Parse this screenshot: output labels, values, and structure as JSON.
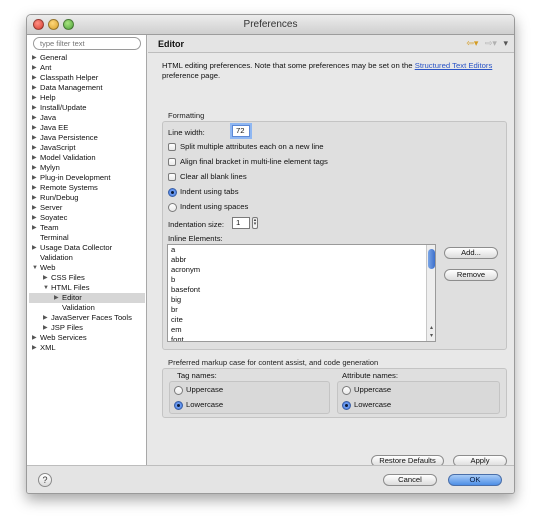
{
  "window": {
    "title": "Preferences"
  },
  "left": {
    "filter_placeholder": "type filter text",
    "tree": [
      {
        "label": "General",
        "indent": 0,
        "arrow": "right"
      },
      {
        "label": "Ant",
        "indent": 0,
        "arrow": "right"
      },
      {
        "label": "Classpath Helper",
        "indent": 0,
        "arrow": "right"
      },
      {
        "label": "Data Management",
        "indent": 0,
        "arrow": "right"
      },
      {
        "label": "Help",
        "indent": 0,
        "arrow": "right"
      },
      {
        "label": "Install/Update",
        "indent": 0,
        "arrow": "right"
      },
      {
        "label": "Java",
        "indent": 0,
        "arrow": "right"
      },
      {
        "label": "Java EE",
        "indent": 0,
        "arrow": "right"
      },
      {
        "label": "Java Persistence",
        "indent": 0,
        "arrow": "right"
      },
      {
        "label": "JavaScript",
        "indent": 0,
        "arrow": "right"
      },
      {
        "label": "Model Validation",
        "indent": 0,
        "arrow": "right"
      },
      {
        "label": "Mylyn",
        "indent": 0,
        "arrow": "right"
      },
      {
        "label": "Plug-in Development",
        "indent": 0,
        "arrow": "right"
      },
      {
        "label": "Remote Systems",
        "indent": 0,
        "arrow": "right"
      },
      {
        "label": "Run/Debug",
        "indent": 0,
        "arrow": "right"
      },
      {
        "label": "Server",
        "indent": 0,
        "arrow": "right"
      },
      {
        "label": "Soyatec",
        "indent": 0,
        "arrow": "right"
      },
      {
        "label": "Team",
        "indent": 0,
        "arrow": "right"
      },
      {
        "label": "Terminal",
        "indent": 0,
        "arrow": "none"
      },
      {
        "label": "Usage Data Collector",
        "indent": 0,
        "arrow": "right"
      },
      {
        "label": "Validation",
        "indent": 0,
        "arrow": "none"
      },
      {
        "label": "Web",
        "indent": 0,
        "arrow": "down"
      },
      {
        "label": "CSS Files",
        "indent": 1,
        "arrow": "right"
      },
      {
        "label": "HTML Files",
        "indent": 1,
        "arrow": "down"
      },
      {
        "label": "Editor",
        "indent": 2,
        "arrow": "right",
        "selected": true
      },
      {
        "label": "Validation",
        "indent": 2,
        "arrow": "none"
      },
      {
        "label": "JavaServer Faces Tools",
        "indent": 1,
        "arrow": "right"
      },
      {
        "label": "JSP Files",
        "indent": 1,
        "arrow": "right"
      },
      {
        "label": "Web Services",
        "indent": 0,
        "arrow": "right"
      },
      {
        "label": "XML",
        "indent": 0,
        "arrow": "right"
      }
    ]
  },
  "right": {
    "header_title": "Editor",
    "description": "HTML editing preferences.  Note that some preferences may be set on the ",
    "description_link": "Structured Text Editors",
    "description_suffix": " preference page.",
    "formatting": {
      "title": "Formatting",
      "line_width_label": "Line width:",
      "line_width_value": "72",
      "split_attributes": "Split multiple attributes each on a new line",
      "align_bracket": "Align final bracket in multi-line element tags",
      "clear_blank": "Clear all blank lines",
      "indent_tabs": "Indent using tabs",
      "indent_spaces": "Indent using spaces",
      "indentation_size_label": "Indentation size:",
      "indentation_size_value": "1",
      "inline_elements_label": "Inline Elements:",
      "inline_elements": [
        "a",
        "abbr",
        "acronym",
        "b",
        "basefont",
        "big",
        "br",
        "cite",
        "em",
        "font"
      ],
      "add_button": "Add...",
      "remove_button": "Remove"
    },
    "markup_case": {
      "title": "Preferred markup case for content assist, and code generation",
      "tag_names_title": "Tag names:",
      "tag_uppercase": "Uppercase",
      "tag_lowercase": "Lowercase",
      "attr_names_title": "Attribute names:",
      "attr_uppercase": "Uppercase",
      "attr_lowercase": "Lowercase"
    },
    "restore_defaults": "Restore Defaults",
    "apply": "Apply"
  },
  "footer": {
    "help_glyph": "?",
    "cancel": "Cancel",
    "ok": "OK"
  },
  "icons": {
    "help": "question-mark-icon",
    "back": "back-arrow-icon",
    "forward": "forward-arrow-icon",
    "menu": "chevron-down-icon"
  },
  "colors": {
    "primary_button": "#4d8ee6",
    "link": "#2a54c6",
    "selection": "#d6d6d6"
  }
}
